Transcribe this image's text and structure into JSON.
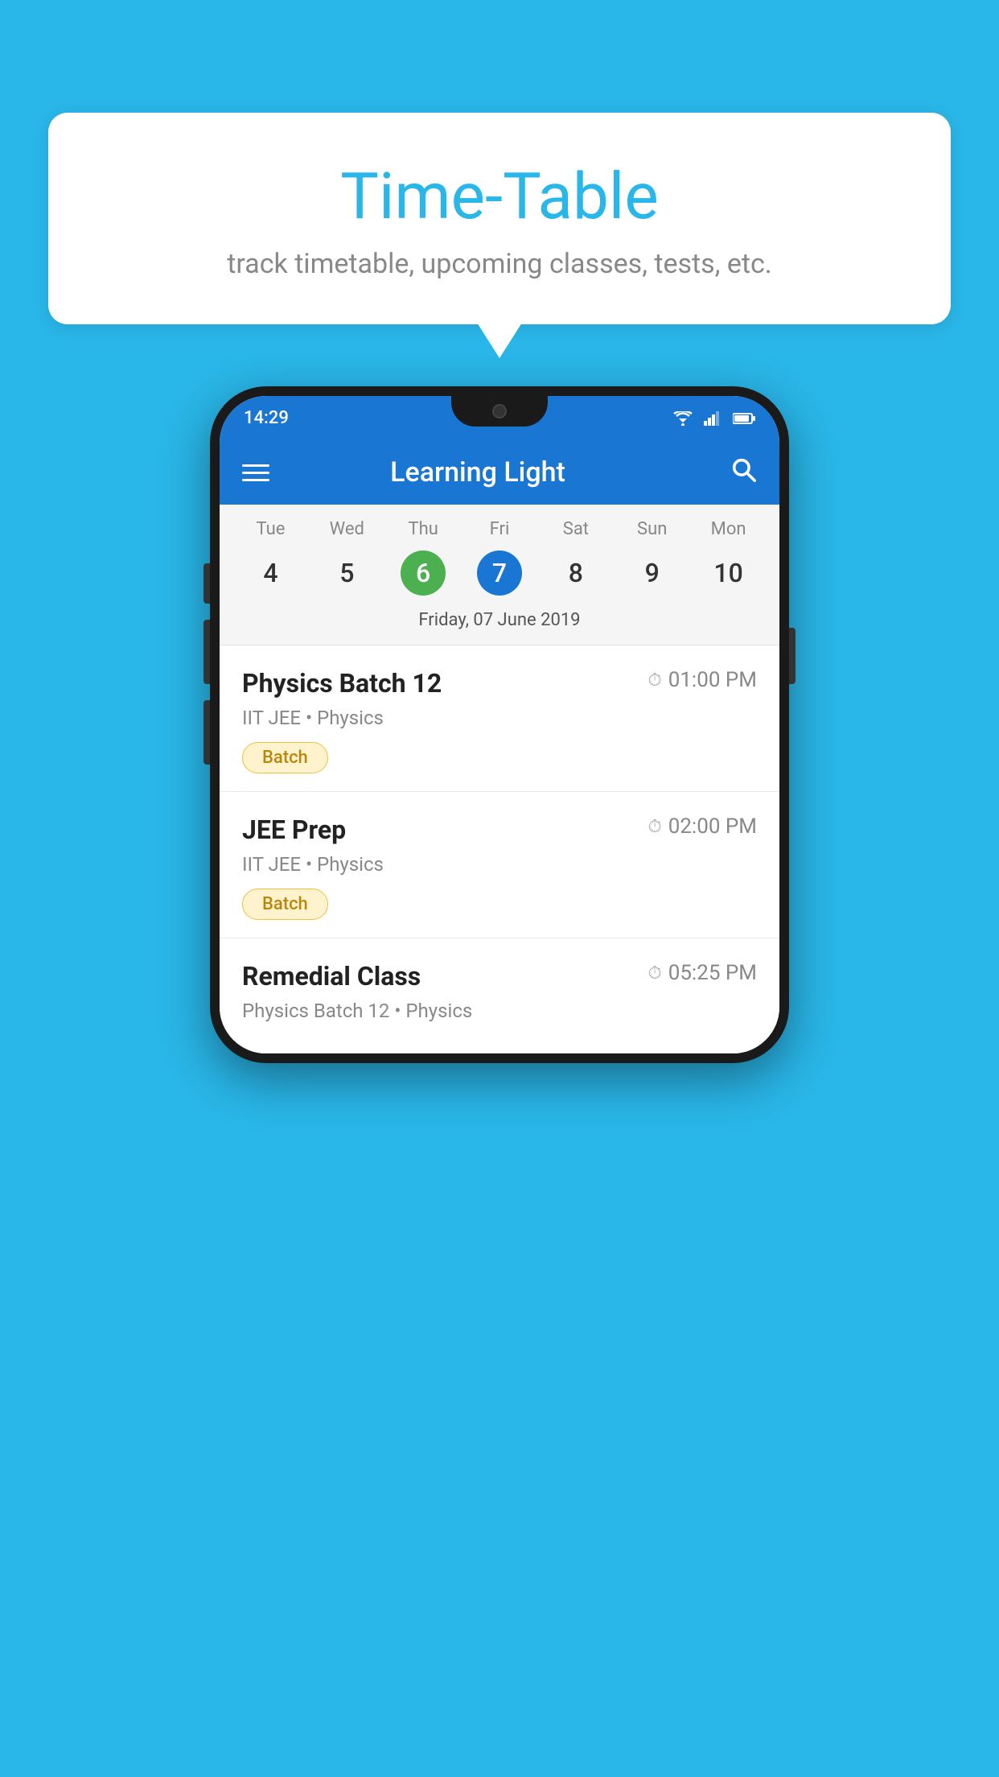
{
  "page": {
    "background_color": "#29B6E8"
  },
  "bubble": {
    "title": "Time-Table",
    "subtitle": "track timetable, upcoming classes, tests, etc."
  },
  "app": {
    "title": "Learning Light",
    "time": "14:29"
  },
  "calendar": {
    "selected_date_label": "Friday, 07 June 2019",
    "days": [
      {
        "name": "Tue",
        "num": "4",
        "state": "normal"
      },
      {
        "name": "Wed",
        "num": "5",
        "state": "normal"
      },
      {
        "name": "Thu",
        "num": "6",
        "state": "today"
      },
      {
        "name": "Fri",
        "num": "7",
        "state": "selected"
      },
      {
        "name": "Sat",
        "num": "8",
        "state": "normal"
      },
      {
        "name": "Sun",
        "num": "9",
        "state": "normal"
      },
      {
        "name": "Mon",
        "num": "10",
        "state": "normal"
      }
    ]
  },
  "classes": [
    {
      "name": "Physics Batch 12",
      "time": "01:00 PM",
      "meta": "IIT JEE • Physics",
      "tag": "Batch"
    },
    {
      "name": "JEE Prep",
      "time": "02:00 PM",
      "meta": "IIT JEE • Physics",
      "tag": "Batch"
    },
    {
      "name": "Remedial Class",
      "time": "05:25 PM",
      "meta": "Physics Batch 12 • Physics",
      "tag": ""
    }
  ],
  "icons": {
    "hamburger": "☰",
    "search": "🔍",
    "clock": "🕐"
  },
  "labels": {
    "batch_tag": "Batch"
  }
}
